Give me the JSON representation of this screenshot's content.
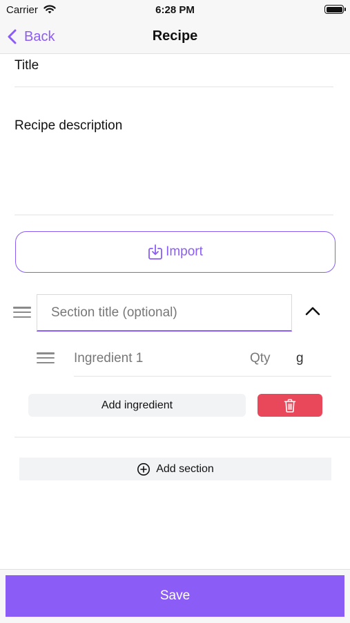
{
  "status_bar": {
    "carrier": "Carrier",
    "time": "6:28 PM",
    "wifi_icon": "wifi-icon",
    "battery_icon": "battery-icon"
  },
  "nav": {
    "back_label": "Back",
    "back_icon": "chevron-left-icon",
    "title": "Recipe"
  },
  "form": {
    "title_placeholder": "Title",
    "description_placeholder": "Recipe description"
  },
  "import": {
    "label": "Import",
    "icon": "import-icon"
  },
  "section": {
    "title_placeholder": "Section title (optional)",
    "collapse_icon": "chevron-up-icon",
    "drag_icon": "drag-handle-icon",
    "ingredients": [
      {
        "name_placeholder": "Ingredient 1",
        "qty_placeholder": "Qty",
        "unit": "g"
      }
    ],
    "add_ingredient_label": "Add ingredient",
    "delete_icon": "trash-icon"
  },
  "add_section": {
    "label": "Add section",
    "icon": "plus-circle-icon"
  },
  "footer": {
    "save_label": "Save"
  },
  "colors": {
    "accent": "#8b5cf6",
    "danger": "#e9475a",
    "button_bg": "#f2f3f5",
    "bar_bg": "#f7f7f7"
  }
}
